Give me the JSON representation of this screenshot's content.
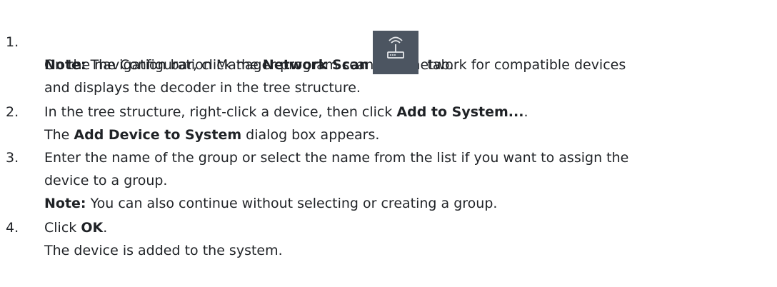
{
  "steps": [
    {
      "number": "1.",
      "lead": "On the navigation bar, click the ",
      "bold": "Network Scan",
      "tail": " tab.",
      "icon": "network-scan-icon",
      "note_label": "Note:",
      "note_text_1": " The Configuration Manager program scans the network for compatible devices",
      "note_text_2": "and displays the decoder in the tree structure."
    },
    {
      "number": "2.",
      "lead": "In the tree structure, right-click a device, then click ",
      "bold": "Add to System...",
      "tail": ".",
      "result_lead": "The ",
      "result_bold": "Add Device to System",
      "result_tail": " dialog box appears."
    },
    {
      "number": "3.",
      "text_1": "Enter the name of the group or select the name from the list if you want to assign the",
      "text_2": "device to a group.",
      "note_label": "Note:",
      "note_text": " You can also continue without selecting or creating a group."
    },
    {
      "number": "4.",
      "lead": "Click ",
      "bold": "OK",
      "tail": ".",
      "result": "The device is added to the system."
    }
  ],
  "colors": {
    "text": "#1f2226",
    "icon_background": "#4c5561",
    "icon_glyph": "#e6e8eb"
  }
}
